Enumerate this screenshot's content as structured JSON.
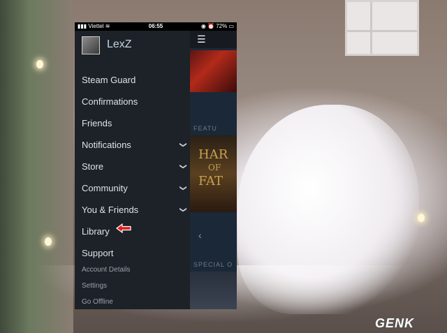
{
  "status_bar": {
    "carrier": "Viettel",
    "time": "06:55",
    "battery": "72%"
  },
  "profile": {
    "username": "LexZ"
  },
  "menu": [
    {
      "label": "Steam Guard",
      "expandable": false
    },
    {
      "label": "Confirmations",
      "expandable": false
    },
    {
      "label": "Friends",
      "expandable": false
    },
    {
      "label": "Notifications",
      "expandable": true
    },
    {
      "label": "Store",
      "expandable": true
    },
    {
      "label": "Community",
      "expandable": true
    },
    {
      "label": "You & Friends",
      "expandable": true
    },
    {
      "label": "Library",
      "expandable": false
    },
    {
      "label": "Support",
      "expandable": false
    }
  ],
  "submenu": [
    "Account Details",
    "Settings",
    "Go Offline"
  ],
  "content": {
    "featured_label": "FEATU",
    "game_title_line1": "HAR",
    "game_title_line2": "OF",
    "game_title_line3": "FAT",
    "special_label": "SPECIAL O"
  },
  "watermark": "GENK",
  "colors": {
    "drawer_bg": "#1d2128",
    "highlight_arrow": "#e02020"
  }
}
